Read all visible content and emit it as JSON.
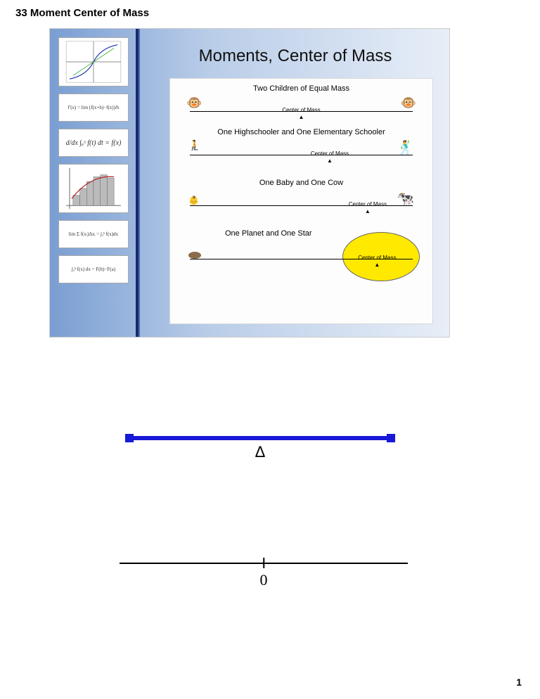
{
  "page_title": "33 Moment Center of Mass",
  "page_number": "1",
  "slide": {
    "title": "Moments, Center of Mass",
    "thumbnails": [
      {
        "kind": "graph"
      },
      {
        "kind": "formula",
        "text": "f'(x) = lim (f(x+h)−f(x))/h"
      },
      {
        "kind": "formula",
        "text": "d/dx ∫ₐˣ f(t) dt = f(x)"
      },
      {
        "kind": "graph"
      },
      {
        "kind": "formula",
        "text": "lim Σ f(xᵢ)Δxᵢ = ∫ₐᵇ f(x)dx"
      },
      {
        "kind": "formula",
        "text": "∫ₐᵇ f(x) dx = F(b)−F(a)"
      }
    ],
    "examples": [
      {
        "label": "Two Children of Equal Mass",
        "left_icon": "🐵",
        "right_icon": "🐵",
        "com_label": "Center of Mass",
        "com_position_pct": 50
      },
      {
        "label": "One Highschooler and One Elementary Schooler",
        "left_icon": "🧎",
        "right_icon": "🕺",
        "com_label": "Center of Mass",
        "com_position_pct": 62
      },
      {
        "label": "One Baby and One Cow",
        "left_icon": "👶",
        "right_icon": "🐄",
        "com_label": "Center of Mass",
        "com_position_pct": 78
      },
      {
        "label": "One Planet and One Star",
        "left_icon": "",
        "right_icon": "",
        "com_label": "Center of Mass",
        "com_position_pct": 88
      }
    ]
  },
  "balance": {
    "fulcrum_symbol": "Δ"
  },
  "numberline": {
    "origin_label": "0"
  }
}
